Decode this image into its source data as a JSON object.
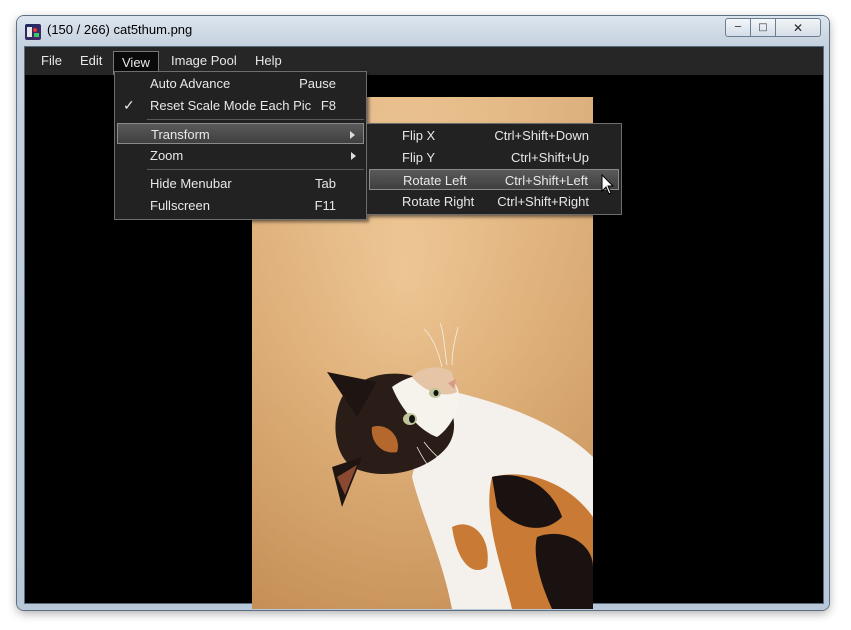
{
  "window": {
    "title": "(150 / 266) cat5thum.png",
    "buttons": {
      "minimize": "─",
      "maximize": "□",
      "close": "✕"
    }
  },
  "menubar": {
    "items": [
      {
        "label": "File"
      },
      {
        "label": "Edit"
      },
      {
        "label": "View"
      },
      {
        "label": "Image Pool"
      },
      {
        "label": "Help"
      }
    ]
  },
  "view_menu": {
    "items": [
      {
        "label": "Auto Advance",
        "shortcut": "Pause",
        "checked": false
      },
      {
        "label": "Reset Scale Mode Each Pic",
        "shortcut": "F8",
        "checked": true,
        "check_glyph": "✓"
      },
      {
        "label": "Transform",
        "shortcut": "",
        "submenu": true,
        "highlighted": true
      },
      {
        "label": "Zoom",
        "shortcut": "",
        "submenu": true
      },
      {
        "label": "Hide Menubar",
        "shortcut": "Tab"
      },
      {
        "label": "Fullscreen",
        "shortcut": "F11"
      }
    ]
  },
  "transform_menu": {
    "items": [
      {
        "label": "Flip X",
        "shortcut": "Ctrl+Shift+Down"
      },
      {
        "label": "Flip Y",
        "shortcut": "Ctrl+Shift+Up"
      },
      {
        "label": "Rotate Left",
        "shortcut": "Ctrl+Shift+Left",
        "highlighted": true
      },
      {
        "label": "Rotate Right",
        "shortcut": "Ctrl+Shift+Right"
      }
    ]
  },
  "colors": {
    "client_bg": "#000000",
    "menubar_bg": "#262626",
    "menu_bg": "#222222",
    "menu_text": "#e8e8e8",
    "photo_bg": "#dcae78"
  }
}
